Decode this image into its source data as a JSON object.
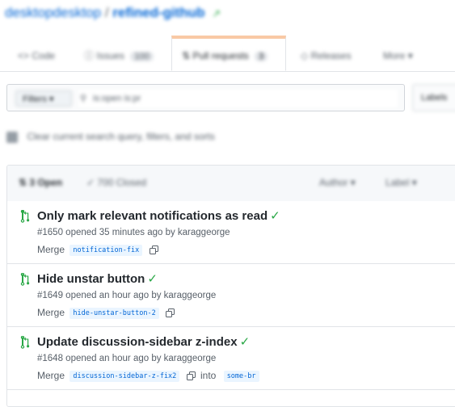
{
  "repo": {
    "owner": "desktopdesktop",
    "separator": "/",
    "name": "refined-github"
  },
  "tabs": [
    {
      "label": "Code"
    },
    {
      "label": "Issues",
      "count": "100"
    },
    {
      "label": "Pull requests",
      "count": "3"
    },
    {
      "label": "Releases"
    },
    {
      "label": "More"
    }
  ],
  "filters": {
    "button_label": "Filters ▾",
    "search_value": "is:open is:pr",
    "labels_label": "Labels"
  },
  "clear_filters": "Clear current search query, filters, and sorts",
  "list_header": {
    "open_label": "3 Open",
    "closed_label": "✓ 700 Closed",
    "author_label": "Author ▾",
    "label_label": "Label ▾"
  },
  "pull_requests": [
    {
      "title": "Only mark relevant notifications as read",
      "check": "✓",
      "meta": "#1650 opened 35 minutes ago by karaggeorge",
      "merge_label": "Merge",
      "branch": "notification-fix",
      "into_label": "",
      "base_branch": ""
    },
    {
      "title": "Hide unstar button",
      "check": "✓",
      "meta": "#1649 opened an hour ago by karaggeorge",
      "merge_label": "Merge",
      "branch": "hide-unstar-button-2",
      "into_label": "",
      "base_branch": ""
    },
    {
      "title": "Update discussion-sidebar z-index",
      "check": "✓",
      "meta": "#1648 opened an hour ago by karaggeorge",
      "merge_label": "Merge",
      "branch": "discussion-sidebar-z-fix2",
      "into_label": "into",
      "base_branch": "some-br"
    }
  ],
  "colors": {
    "link": "#0366d6",
    "success": "#28a745",
    "muted": "#586069",
    "branch_bg": "#eaf5ff"
  }
}
